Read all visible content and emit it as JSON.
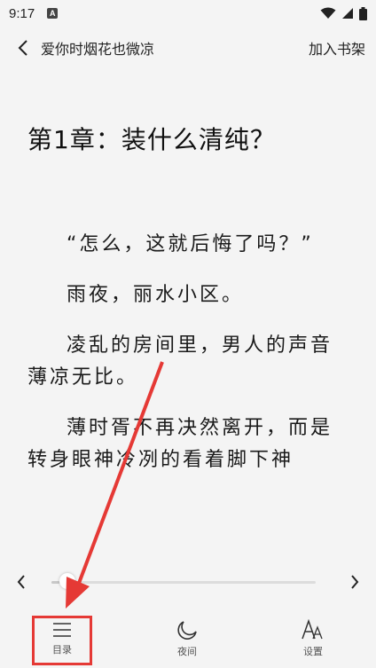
{
  "status_bar": {
    "time": "9:17",
    "notification_icon": "a-notification-icon"
  },
  "header": {
    "book_title": "爱你时烟花也微凉",
    "bookshelf_label": "加入书架"
  },
  "chapter": {
    "title": "第1章：装什么清纯？",
    "paragraphs": [
      "“怎么，这就后悔了吗？”",
      "雨夜，丽水小区。",
      "凌乱的房间里，男人的声音薄凉无比。",
      "薄时胥不再决然离开，而是转身眼神冷冽的看着脚下神"
    ]
  },
  "progress": {
    "fraction": 0.03
  },
  "bottom_nav": {
    "catalog_label": "目录",
    "night_label": "夜间",
    "settings_label": "设置"
  },
  "colors": {
    "background": "#f4f4f4",
    "annotation_red": "#e53935"
  }
}
